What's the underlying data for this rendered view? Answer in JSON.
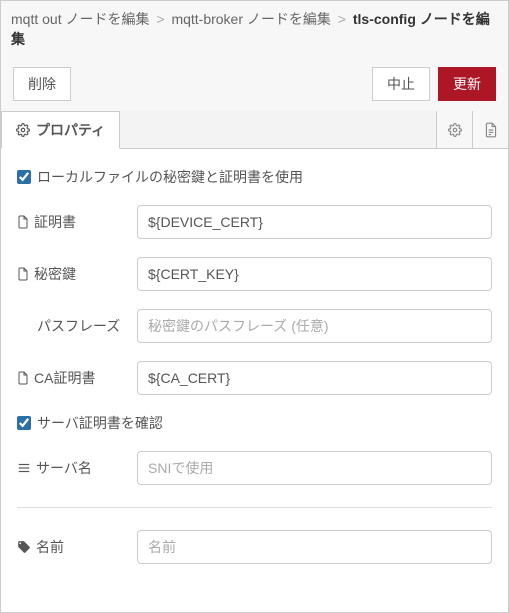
{
  "breadcrumb": {
    "crumb1": "mqtt out ノードを編集",
    "crumb2": "mqtt-broker ノードを編集",
    "current": "tls-config ノードを編集"
  },
  "toolbar": {
    "delete_label": "削除",
    "cancel_label": "中止",
    "update_label": "更新"
  },
  "tab": {
    "label": "プロパティ"
  },
  "form": {
    "use_local_files_label": "ローカルファイルの秘密鍵と証明書を使用",
    "cert_label": "証明書",
    "cert_value": "${DEVICE_CERT}",
    "key_label": "秘密鍵",
    "key_value": "${CERT_KEY}",
    "passphrase_label": "パスフレーズ",
    "passphrase_placeholder": "秘密鍵のパスフレーズ (任意)",
    "ca_label": "CA証明書",
    "ca_value": "${CA_CERT}",
    "verify_server_label": "サーバ証明書を確認",
    "servername_label": "サーバ名",
    "servername_placeholder": "SNIで使用",
    "name_label": "名前",
    "name_placeholder": "名前"
  }
}
